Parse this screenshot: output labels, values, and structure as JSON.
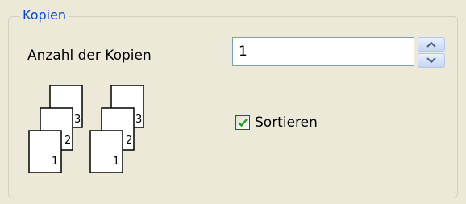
{
  "group": {
    "title": "Kopien"
  },
  "copies": {
    "label": "Anzahl der Kopien",
    "value": "1"
  },
  "collate": {
    "label": "Sortieren",
    "checked": true
  },
  "icon_stacks": [
    {
      "pages": [
        "1",
        "2",
        "3"
      ]
    },
    {
      "pages": [
        "1",
        "2",
        "3"
      ]
    }
  ],
  "colors": {
    "background": "#ece9d8",
    "group_title": "#0046d5",
    "check_mark": "#21a121"
  }
}
